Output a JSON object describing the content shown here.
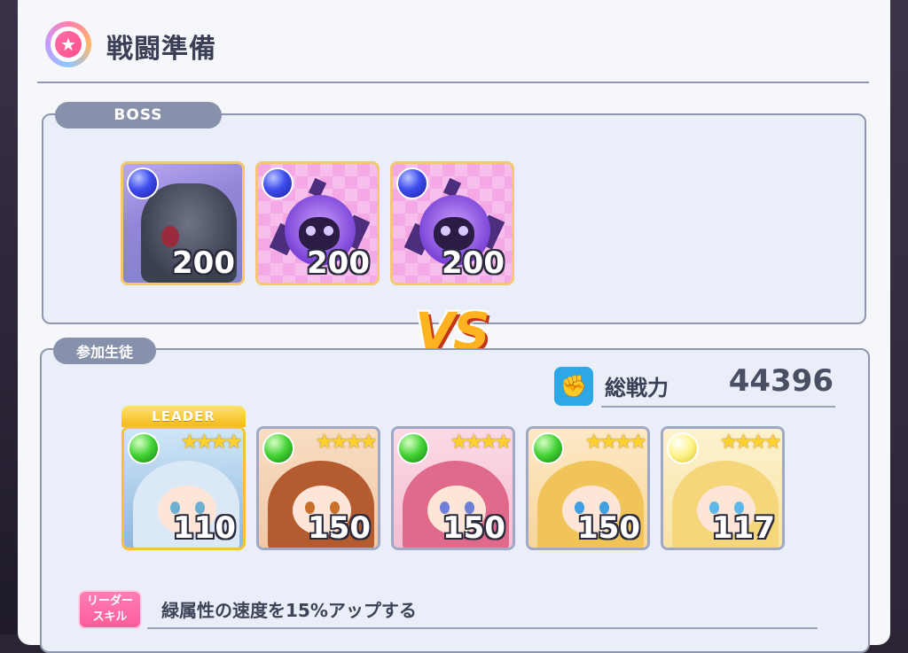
{
  "header": {
    "title": "戦闘準備",
    "icon": "star-icon"
  },
  "boss_section": {
    "label": "BOSS",
    "bosses": [
      {
        "name": "golem",
        "element": "blue",
        "level": "200"
      },
      {
        "name": "purple-skull",
        "element": "blue",
        "level": "200"
      },
      {
        "name": "purple-skull",
        "element": "blue",
        "level": "200"
      }
    ]
  },
  "vs_text": "VS",
  "party_section": {
    "label": "参加生徒",
    "total_power_label": "総戦力",
    "total_power_value": "44396",
    "leader_tag": "LEADER",
    "members": [
      {
        "element": "green",
        "level": "110",
        "stars": "★★★★",
        "hair": "#cfe3f7"
      },
      {
        "element": "green",
        "level": "150",
        "stars": "★★★★",
        "hair": "#b45b2f"
      },
      {
        "element": "green",
        "level": "150",
        "stars": "★★★★",
        "hair": "#e06a8c"
      },
      {
        "element": "green",
        "level": "150",
        "stars": "★★★★",
        "hair": "#f1c45a"
      },
      {
        "element": "yellow",
        "level": "117",
        "stars": "★★★★",
        "hair": "#f5d67a"
      }
    ]
  },
  "leader_skill": {
    "badge_line1": "リーダー",
    "badge_line2": "スキル",
    "text": "緑属性の速度を15%アップする"
  }
}
